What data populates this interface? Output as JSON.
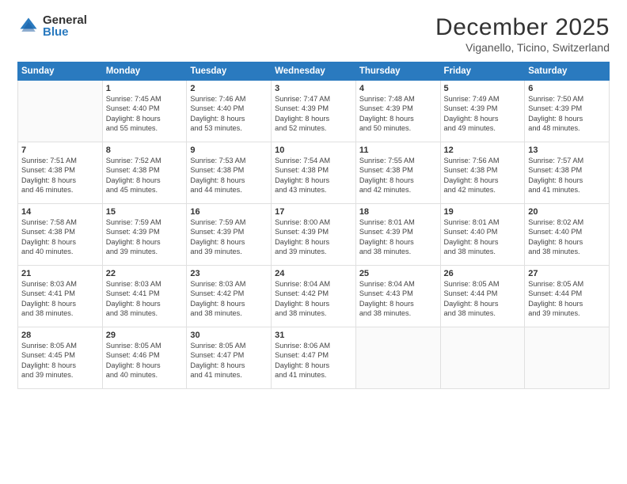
{
  "header": {
    "logo_general": "General",
    "logo_blue": "Blue",
    "month_title": "December 2025",
    "location": "Viganello, Ticino, Switzerland"
  },
  "weekdays": [
    "Sunday",
    "Monday",
    "Tuesday",
    "Wednesday",
    "Thursday",
    "Friday",
    "Saturday"
  ],
  "rows": [
    [
      {
        "day": "",
        "lines": []
      },
      {
        "day": "1",
        "lines": [
          "Sunrise: 7:45 AM",
          "Sunset: 4:40 PM",
          "Daylight: 8 hours",
          "and 55 minutes."
        ]
      },
      {
        "day": "2",
        "lines": [
          "Sunrise: 7:46 AM",
          "Sunset: 4:40 PM",
          "Daylight: 8 hours",
          "and 53 minutes."
        ]
      },
      {
        "day": "3",
        "lines": [
          "Sunrise: 7:47 AM",
          "Sunset: 4:39 PM",
          "Daylight: 8 hours",
          "and 52 minutes."
        ]
      },
      {
        "day": "4",
        "lines": [
          "Sunrise: 7:48 AM",
          "Sunset: 4:39 PM",
          "Daylight: 8 hours",
          "and 50 minutes."
        ]
      },
      {
        "day": "5",
        "lines": [
          "Sunrise: 7:49 AM",
          "Sunset: 4:39 PM",
          "Daylight: 8 hours",
          "and 49 minutes."
        ]
      },
      {
        "day": "6",
        "lines": [
          "Sunrise: 7:50 AM",
          "Sunset: 4:39 PM",
          "Daylight: 8 hours",
          "and 48 minutes."
        ]
      }
    ],
    [
      {
        "day": "7",
        "lines": [
          "Sunrise: 7:51 AM",
          "Sunset: 4:38 PM",
          "Daylight: 8 hours",
          "and 46 minutes."
        ]
      },
      {
        "day": "8",
        "lines": [
          "Sunrise: 7:52 AM",
          "Sunset: 4:38 PM",
          "Daylight: 8 hours",
          "and 45 minutes."
        ]
      },
      {
        "day": "9",
        "lines": [
          "Sunrise: 7:53 AM",
          "Sunset: 4:38 PM",
          "Daylight: 8 hours",
          "and 44 minutes."
        ]
      },
      {
        "day": "10",
        "lines": [
          "Sunrise: 7:54 AM",
          "Sunset: 4:38 PM",
          "Daylight: 8 hours",
          "and 43 minutes."
        ]
      },
      {
        "day": "11",
        "lines": [
          "Sunrise: 7:55 AM",
          "Sunset: 4:38 PM",
          "Daylight: 8 hours",
          "and 42 minutes."
        ]
      },
      {
        "day": "12",
        "lines": [
          "Sunrise: 7:56 AM",
          "Sunset: 4:38 PM",
          "Daylight: 8 hours",
          "and 42 minutes."
        ]
      },
      {
        "day": "13",
        "lines": [
          "Sunrise: 7:57 AM",
          "Sunset: 4:38 PM",
          "Daylight: 8 hours",
          "and 41 minutes."
        ]
      }
    ],
    [
      {
        "day": "14",
        "lines": [
          "Sunrise: 7:58 AM",
          "Sunset: 4:38 PM",
          "Daylight: 8 hours",
          "and 40 minutes."
        ]
      },
      {
        "day": "15",
        "lines": [
          "Sunrise: 7:59 AM",
          "Sunset: 4:39 PM",
          "Daylight: 8 hours",
          "and 39 minutes."
        ]
      },
      {
        "day": "16",
        "lines": [
          "Sunrise: 7:59 AM",
          "Sunset: 4:39 PM",
          "Daylight: 8 hours",
          "and 39 minutes."
        ]
      },
      {
        "day": "17",
        "lines": [
          "Sunrise: 8:00 AM",
          "Sunset: 4:39 PM",
          "Daylight: 8 hours",
          "and 39 minutes."
        ]
      },
      {
        "day": "18",
        "lines": [
          "Sunrise: 8:01 AM",
          "Sunset: 4:39 PM",
          "Daylight: 8 hours",
          "and 38 minutes."
        ]
      },
      {
        "day": "19",
        "lines": [
          "Sunrise: 8:01 AM",
          "Sunset: 4:40 PM",
          "Daylight: 8 hours",
          "and 38 minutes."
        ]
      },
      {
        "day": "20",
        "lines": [
          "Sunrise: 8:02 AM",
          "Sunset: 4:40 PM",
          "Daylight: 8 hours",
          "and 38 minutes."
        ]
      }
    ],
    [
      {
        "day": "21",
        "lines": [
          "Sunrise: 8:03 AM",
          "Sunset: 4:41 PM",
          "Daylight: 8 hours",
          "and 38 minutes."
        ]
      },
      {
        "day": "22",
        "lines": [
          "Sunrise: 8:03 AM",
          "Sunset: 4:41 PM",
          "Daylight: 8 hours",
          "and 38 minutes."
        ]
      },
      {
        "day": "23",
        "lines": [
          "Sunrise: 8:03 AM",
          "Sunset: 4:42 PM",
          "Daylight: 8 hours",
          "and 38 minutes."
        ]
      },
      {
        "day": "24",
        "lines": [
          "Sunrise: 8:04 AM",
          "Sunset: 4:42 PM",
          "Daylight: 8 hours",
          "and 38 minutes."
        ]
      },
      {
        "day": "25",
        "lines": [
          "Sunrise: 8:04 AM",
          "Sunset: 4:43 PM",
          "Daylight: 8 hours",
          "and 38 minutes."
        ]
      },
      {
        "day": "26",
        "lines": [
          "Sunrise: 8:05 AM",
          "Sunset: 4:44 PM",
          "Daylight: 8 hours",
          "and 38 minutes."
        ]
      },
      {
        "day": "27",
        "lines": [
          "Sunrise: 8:05 AM",
          "Sunset: 4:44 PM",
          "Daylight: 8 hours",
          "and 39 minutes."
        ]
      }
    ],
    [
      {
        "day": "28",
        "lines": [
          "Sunrise: 8:05 AM",
          "Sunset: 4:45 PM",
          "Daylight: 8 hours",
          "and 39 minutes."
        ]
      },
      {
        "day": "29",
        "lines": [
          "Sunrise: 8:05 AM",
          "Sunset: 4:46 PM",
          "Daylight: 8 hours",
          "and 40 minutes."
        ]
      },
      {
        "day": "30",
        "lines": [
          "Sunrise: 8:05 AM",
          "Sunset: 4:47 PM",
          "Daylight: 8 hours",
          "and 41 minutes."
        ]
      },
      {
        "day": "31",
        "lines": [
          "Sunrise: 8:06 AM",
          "Sunset: 4:47 PM",
          "Daylight: 8 hours",
          "and 41 minutes."
        ]
      },
      {
        "day": "",
        "lines": []
      },
      {
        "day": "",
        "lines": []
      },
      {
        "day": "",
        "lines": []
      }
    ]
  ]
}
